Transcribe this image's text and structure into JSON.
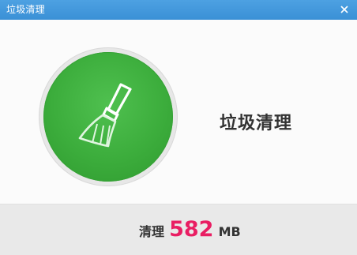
{
  "window": {
    "title": "垃圾清理",
    "close_icon": "close-icon"
  },
  "main": {
    "big_label": "垃圾清理",
    "broom_icon": "broom-icon"
  },
  "footer": {
    "prefix": "清理",
    "value": "582",
    "unit": "MB",
    "value_color": "#e91e63"
  },
  "colors": {
    "titlebar": "#3a90d6",
    "circle_green": "#3cad3c"
  }
}
